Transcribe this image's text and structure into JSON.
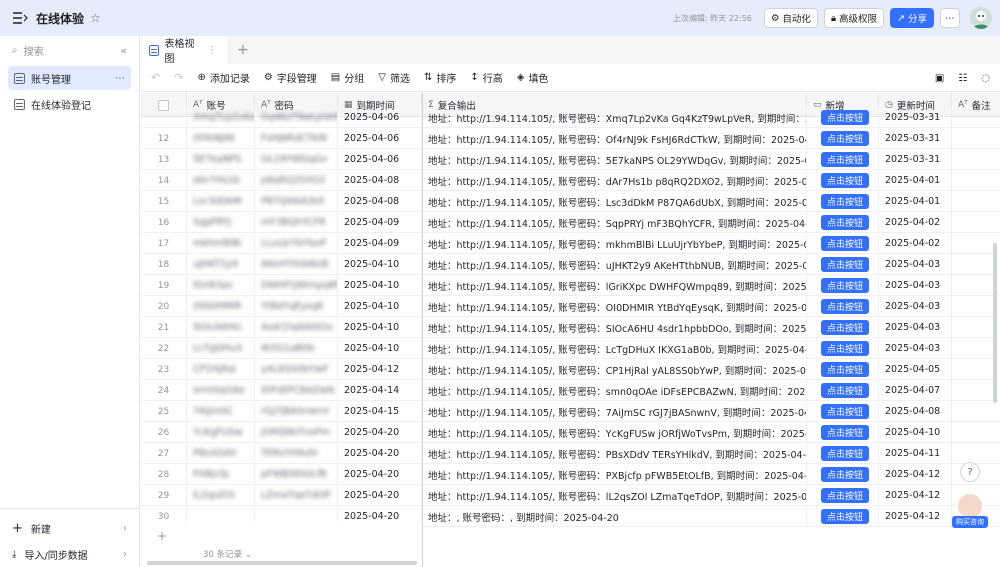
{
  "app": {
    "title": "在线体验",
    "last_edited": "上次编辑: 昨天 22:56",
    "buttons": {
      "automation": "自动化",
      "permissions": "高级权限",
      "share": "分享"
    }
  },
  "sidebar": {
    "search_placeholder": "搜索",
    "items": [
      {
        "label": "账号管理",
        "active": true
      },
      {
        "label": "在线体验登记",
        "active": false
      }
    ],
    "bottom": [
      {
        "label": "新建"
      },
      {
        "label": "导入/同步数据"
      }
    ]
  },
  "view_tabs": [
    {
      "label": "表格视图"
    }
  ],
  "toolbar": {
    "add_record": "添加记录",
    "field_manage": "字段管理",
    "group": "分组",
    "filter": "筛选",
    "sort": "排序",
    "row_height": "行高",
    "fill": "填色"
  },
  "table": {
    "columns": {
      "account": "账号",
      "password": "密码",
      "expire": "到期时间",
      "composite": "复合输出",
      "add": "新增",
      "updated": "更新时间",
      "note": "备注"
    },
    "button_label": "点击按钮",
    "rows": [
      {
        "num": "",
        "account": "Xmq7Lp2vKa",
        "password": "Gq4KzT9wLpVeR",
        "expire": "2025-04-06",
        "composite": "地址：http://1.94.114.105/, 账号密码：Xmq7Lp2vKa Gq4KzT9wLpVeR, 到期时间：2025-04-06",
        "updated": "2025-03-31"
      },
      {
        "num": "12",
        "account": "Of4rNJ9k",
        "password": "FsHJ6RdCTkW",
        "expire": "2025-04-06",
        "composite": "地址：http://1.94.114.105/, 账号密码：Of4rNJ9k FsHJ6RdCTkW, 到期时间：2025-04-06",
        "updated": "2025-03-31"
      },
      {
        "num": "13",
        "account": "5E7kaNPS",
        "password": "OL29YWDqGv",
        "expire": "2025-04-06",
        "composite": "地址：http://1.94.114.105/, 账号密码：5E7kaNPS OL29YWDqGv, 到期时间：2025-04-...",
        "updated": "2025-03-31"
      },
      {
        "num": "14",
        "account": "dAr7Hs1b",
        "password": "p8qRQ2DXO2",
        "expire": "2025-04-08",
        "composite": "地址：http://1.94.114.105/, 账号密码：dAr7Hs1b p8qRQ2DXO2, 到期时间：2025-04-08",
        "updated": "2025-04-01"
      },
      {
        "num": "15",
        "account": "Lsc3dDkM",
        "password": "P87QA6dUbX",
        "expire": "2025-04-08",
        "composite": "地址：http://1.94.114.105/, 账号密码：Lsc3dDkM P87QA6dUbX, 到期时间：2025-04-08",
        "updated": "2025-04-01"
      },
      {
        "num": "16",
        "account": "SqpPRYj",
        "password": "mF3BQhYCFR",
        "expire": "2025-04-09",
        "composite": "地址：http://1.94.114.105/, 账号密码：SqpPRYj mF3BQhYCFR, 到期时间：2025-04-09",
        "updated": "2025-04-02"
      },
      {
        "num": "17",
        "account": "mkhmBlBi",
        "password": "LLuUjrYbYbeP",
        "expire": "2025-04-09",
        "composite": "地址：http://1.94.114.105/, 账号密码：mkhmBlBi LLuUjrYbYbeP, 到期时间：2025-04-09",
        "updated": "2025-04-02"
      },
      {
        "num": "18",
        "account": "uJHKT2y9",
        "password": "AKeHTthbNUB",
        "expire": "2025-04-10",
        "composite": "地址：http://1.94.114.105/, 账号密码：uJHKT2y9 AKeHTthbNUB, 到期时间：2025-04-10",
        "updated": "2025-04-03"
      },
      {
        "num": "19",
        "account": "lGriKXpc",
        "password": "DWHFQWmpq89",
        "expire": "2025-04-10",
        "composite": "地址：http://1.94.114.105/, 账号密码：lGriKXpc DWHFQWmpq89, 到期时间：2025-04-10",
        "updated": "2025-04-03"
      },
      {
        "num": "20",
        "account": "OI0DHMIR",
        "password": "YtBdYqEysqK",
        "expire": "2025-04-10",
        "composite": "地址：http://1.94.114.105/, 账号密码：OI0DHMIR YtBdYqEysqK, 到期时间：2025-04-10",
        "updated": "2025-04-03"
      },
      {
        "num": "21",
        "account": "SIOcA6HU",
        "password": "4sdr1hpbbDOo",
        "expire": "2025-04-10",
        "composite": "地址：http://1.94.114.105/, 账号密码：SIOcA6HU 4sdr1hpbbDOo, 到期时间：2025-04-10",
        "updated": "2025-04-03"
      },
      {
        "num": "22",
        "account": "LcTgDHuX",
        "password": "IKXG1aB0b",
        "expire": "2025-04-10",
        "composite": "地址：http://1.94.114.105/, 账号密码：LcTgDHuX IKXG1aB0b, 到期时间：2025-04-10",
        "updated": "2025-04-03"
      },
      {
        "num": "23",
        "account": "CP1HjRal",
        "password": "yAL8SS0bYwP",
        "expire": "2025-04-12",
        "composite": "地址：http://1.94.114.105/, 账号密码：CP1HjRal yAL8SS0bYwP, 到期时间：2025-04-12",
        "updated": "2025-04-05"
      },
      {
        "num": "24",
        "account": "smn0qOAe",
        "password": "iDFsEPCBAZwN",
        "expire": "2025-04-14",
        "composite": "地址：http://1.94.114.105/, 账号密码：smn0qOAe iDFsEPCBAZwN, 到期时间：2025-04-14",
        "updated": "2025-04-07"
      },
      {
        "num": "25",
        "account": "7AiJmSC",
        "password": "rGJ7jBASnwnV",
        "expire": "2025-04-15",
        "composite": "地址：http://1.94.114.105/, 账号密码：7AiJmSC rGJ7jBASnwnV, 到期时间：2025-04-15",
        "updated": "2025-04-08"
      },
      {
        "num": "26",
        "account": "YcKgFUSw",
        "password": "jORfjWoTvsPm",
        "expire": "2025-04-20",
        "composite": "地址：http://1.94.114.105/, 账号密码：YcKgFUSw jORfjWoTvsPm, 到期时间：2025-04-20",
        "updated": "2025-04-10"
      },
      {
        "num": "27",
        "account": "PBsXDdV",
        "password": "TERsYHlkdV",
        "expire": "2025-04-20",
        "composite": "地址：http://1.94.114.105/, 账号密码：PBsXDdV TERsYHlkdV, 到期时间：2025-04-20",
        "updated": "2025-04-11"
      },
      {
        "num": "28",
        "account": "PXBjcfp",
        "password": "pFWB5EtOLfB",
        "expire": "2025-04-20",
        "composite": "地址：http://1.94.114.105/, 账号密码：PXBjcfp pFWB5EtOLfB, 到期时间：2025-04-20",
        "updated": "2025-04-12"
      },
      {
        "num": "29",
        "account": "lL2qsZOl",
        "password": "LZmaTqeTdOP",
        "expire": "2025-04-20",
        "composite": "地址：http://1.94.114.105/, 账号密码：lL2qsZOl LZmaTqeTdOP, 到期时间：2025-04-20",
        "updated": "2025-04-12"
      },
      {
        "num": "30",
        "account": "",
        "password": "",
        "expire": "2025-04-20",
        "composite": "地址：, 账号密码：, 到期时间：2025-04-20",
        "updated": "2025-04-12"
      }
    ],
    "record_count": "30 条记录"
  },
  "floating": {
    "help": "?",
    "consult": "购买咨询"
  },
  "colors": {
    "accent": "#3370ff",
    "topbar": "#e6ecf9",
    "active_item": "#e1eaff"
  }
}
